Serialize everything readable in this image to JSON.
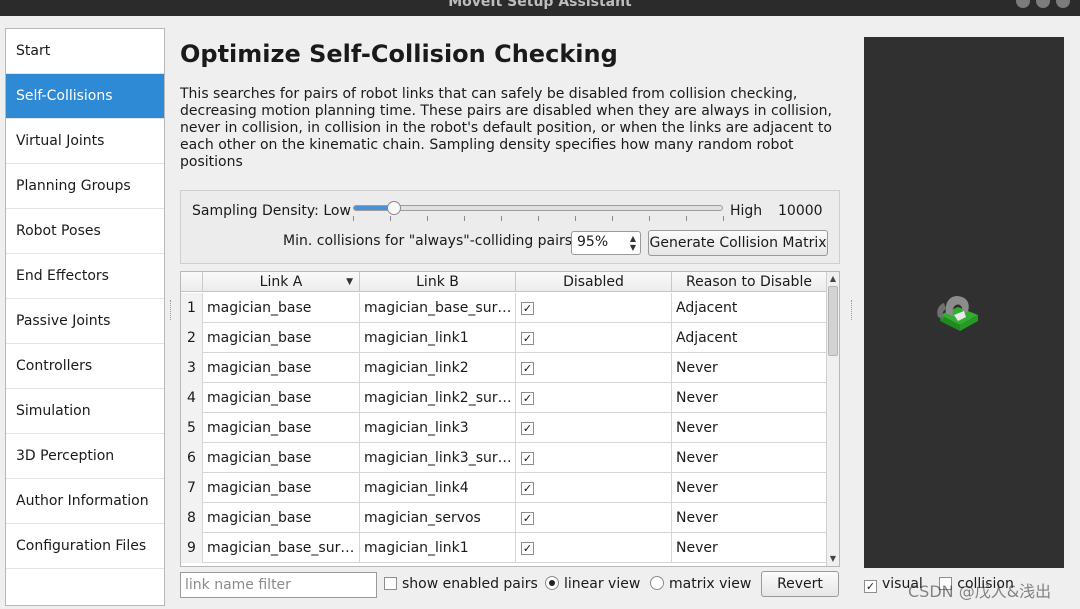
{
  "window": {
    "title": "MoveIt Setup Assistant"
  },
  "sidebar": {
    "items": [
      {
        "label": "Start",
        "active": false
      },
      {
        "label": "Self-Collisions",
        "active": true
      },
      {
        "label": "Virtual Joints",
        "active": false
      },
      {
        "label": "Planning Groups",
        "active": false
      },
      {
        "label": "Robot Poses",
        "active": false
      },
      {
        "label": "End Effectors",
        "active": false
      },
      {
        "label": "Passive Joints",
        "active": false
      },
      {
        "label": "Controllers",
        "active": false
      },
      {
        "label": "Simulation",
        "active": false
      },
      {
        "label": "3D Perception",
        "active": false
      },
      {
        "label": "Author Information",
        "active": false
      },
      {
        "label": "Configuration Files",
        "active": false
      }
    ]
  },
  "main": {
    "title": "Optimize Self-Collision Checking",
    "description": "This searches for pairs of robot links that can safely be disabled from collision checking, decreasing motion planning time. These pairs are disabled when they are always in collision, never in collision, in collision in the robot's default position, or when the links are adjacent to each other on the kinematic chain. Sampling density specifies how many random robot positions",
    "sampling": {
      "label": "Sampling Density: Low",
      "high_label": "High",
      "value": "10000",
      "slider_fraction": 0.11
    },
    "min_collisions": {
      "label": "Min. collisions for \"always\"-colliding pairs:",
      "value": "95%"
    },
    "generate_button": "Generate Collision Matrix",
    "table": {
      "headers": [
        "Link A",
        "Link B",
        "Disabled",
        "Reason to Disable"
      ],
      "rows": [
        {
          "num": "1",
          "link_a": "magician_base",
          "link_b": "magician_base_surf…",
          "disabled": true,
          "reason": "Adjacent"
        },
        {
          "num": "2",
          "link_a": "magician_base",
          "link_b": "magician_link1",
          "disabled": true,
          "reason": "Adjacent"
        },
        {
          "num": "3",
          "link_a": "magician_base",
          "link_b": "magician_link2",
          "disabled": true,
          "reason": "Never"
        },
        {
          "num": "4",
          "link_a": "magician_base",
          "link_b": "magician_link2_sur…",
          "disabled": true,
          "reason": "Never"
        },
        {
          "num": "5",
          "link_a": "magician_base",
          "link_b": "magician_link3",
          "disabled": true,
          "reason": "Never"
        },
        {
          "num": "6",
          "link_a": "magician_base",
          "link_b": "magician_link3_sur…",
          "disabled": true,
          "reason": "Never"
        },
        {
          "num": "7",
          "link_a": "magician_base",
          "link_b": "magician_link4",
          "disabled": true,
          "reason": "Never"
        },
        {
          "num": "8",
          "link_a": "magician_base",
          "link_b": "magician_servos",
          "disabled": true,
          "reason": "Never"
        },
        {
          "num": "9",
          "link_a": "magician_base_surf…",
          "link_b": "magician_link1",
          "disabled": true,
          "reason": "Never"
        }
      ]
    },
    "filter": {
      "placeholder": "link name filter",
      "value": ""
    },
    "show_enabled": {
      "label": "show enabled pairs",
      "checked": false
    },
    "linear_view": {
      "label": "linear view",
      "selected": true
    },
    "matrix_view": {
      "label": "matrix view",
      "selected": false
    },
    "revert_button": "Revert"
  },
  "viewport": {
    "visual": {
      "label": "visual",
      "checked": true
    },
    "collision": {
      "label": "collision",
      "checked": false
    }
  },
  "watermark": "CSDN @戊人&浅出",
  "icons": {
    "check": "✓",
    "sort": "▼",
    "spin_up": "▲",
    "spin_down": "▼"
  }
}
